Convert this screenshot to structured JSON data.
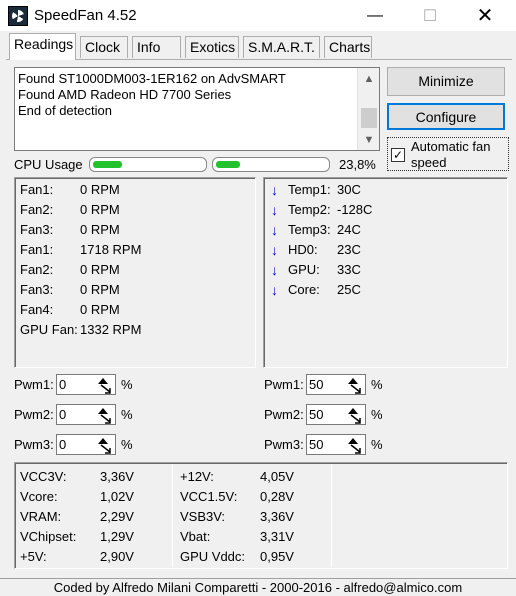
{
  "window": {
    "title": "SpeedFan 4.52",
    "min_glyph": "—",
    "max_glyph": "☐",
    "close_glyph": "✕"
  },
  "tabs": [
    {
      "label": "Readings"
    },
    {
      "label": "Clock"
    },
    {
      "label": "Info"
    },
    {
      "label": "Exotics"
    },
    {
      "label": "S.M.A.R.T."
    },
    {
      "label": "Charts"
    }
  ],
  "log": {
    "lines": [
      "Found ST1000DM003-1ER162 on AdvSMART",
      "Found AMD Radeon HD 7700 Series",
      "End of detection"
    ]
  },
  "buttons": {
    "minimize": "Minimize",
    "configure": "Configure"
  },
  "auto_fan": {
    "label": "Automatic fan speed",
    "checked": true,
    "check_glyph": "✓"
  },
  "cpu": {
    "label": "CPU Usage",
    "percent_text": "23,8%",
    "core_levels": [
      0.26,
      0.22
    ]
  },
  "fans": [
    {
      "label": "Fan1:",
      "value": "0 RPM"
    },
    {
      "label": "Fan2:",
      "value": "0 RPM"
    },
    {
      "label": "Fan3:",
      "value": "0 RPM"
    },
    {
      "label": "Fan1:",
      "value": "1718 RPM"
    },
    {
      "label": "Fan2:",
      "value": "0 RPM"
    },
    {
      "label": "Fan3:",
      "value": "0 RPM"
    },
    {
      "label": "Fan4:",
      "value": "0 RPM"
    },
    {
      "label": "GPU Fan:",
      "value": "1332 RPM"
    }
  ],
  "temps": [
    {
      "label": "Temp1:",
      "value": "30C",
      "arrow": "down-arrow"
    },
    {
      "label": "Temp2:",
      "value": "-128C",
      "arrow": "down-arrow"
    },
    {
      "label": "Temp3:",
      "value": "24C",
      "arrow": "down-arrow"
    },
    {
      "label": "HD0:",
      "value": "23C",
      "arrow": "down-arrow"
    },
    {
      "label": "GPU:",
      "value": "33C",
      "arrow": "down-arrow"
    },
    {
      "label": "Core:",
      "value": "25C",
      "arrow": "down-arrow"
    }
  ],
  "arrow_glyph": "↓",
  "pwm_left": [
    {
      "label": "Pwm1:",
      "value": "0"
    },
    {
      "label": "Pwm2:",
      "value": "0"
    },
    {
      "label": "Pwm3:",
      "value": "0"
    }
  ],
  "pwm_right": [
    {
      "label": "Pwm1:",
      "value": "50"
    },
    {
      "label": "Pwm2:",
      "value": "50"
    },
    {
      "label": "Pwm3:",
      "value": "50"
    }
  ],
  "pct_sign": "%",
  "voltages_col1": [
    {
      "label": "VCC3V:",
      "value": "3,36V"
    },
    {
      "label": "Vcore:",
      "value": "1,02V"
    },
    {
      "label": "VRAM:",
      "value": "2,29V"
    },
    {
      "label": "VChipset:",
      "value": "1,29V"
    },
    {
      "label": "+5V:",
      "value": "2,90V"
    }
  ],
  "voltages_col2": [
    {
      "label": "+12V:",
      "value": "4,05V"
    },
    {
      "label": "VCC1.5V:",
      "value": "0,28V"
    },
    {
      "label": "VSB3V:",
      "value": "3,36V"
    },
    {
      "label": "Vbat:",
      "value": "3,31V"
    },
    {
      "label": "GPU Vddc:",
      "value": "0,95V"
    }
  ],
  "status": "Coded by Alfredo Milani Comparetti - 2000-2016 - alfredo@almico.com",
  "colors": {
    "cpu_bar": "#22c22e",
    "temp_arrow": "#0000d0",
    "accent": "#0078d7"
  }
}
